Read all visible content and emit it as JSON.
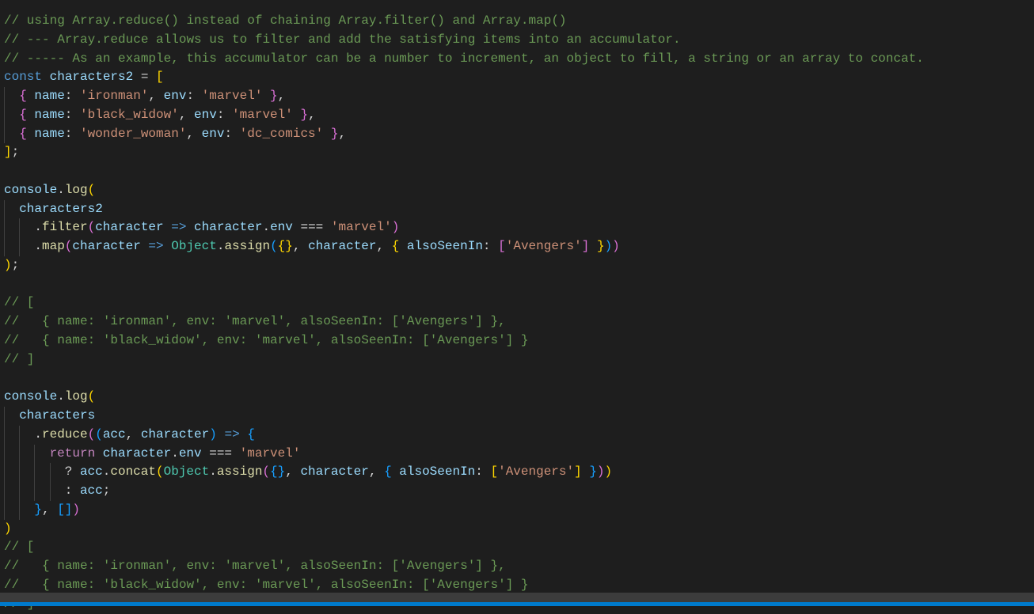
{
  "colors": {
    "background": "#1e1e1e",
    "comment": "#6a9955",
    "keyword": "#569cd6",
    "variable": "#9cdcfe",
    "string": "#ce9178",
    "status_bar": "#007acc"
  },
  "lines": [
    [
      [
        "c",
        "// using Array.reduce() instead of chaining Array.filter() and Array.map()"
      ]
    ],
    [
      [
        "c",
        "// --- Array.reduce allows us to filter and add the satisfying items into an accumulator."
      ]
    ],
    [
      [
        "c",
        "// ----- As an example, this accumulator can be a number to increment, an object to fill, a string or an array to concat."
      ]
    ],
    [
      [
        "k",
        "const "
      ],
      [
        "v",
        "characters2"
      ],
      [
        "p",
        " = "
      ],
      [
        "b1",
        "["
      ]
    ],
    [
      [
        "g",
        ""
      ],
      [
        "b2",
        "{ "
      ],
      [
        "v",
        "name"
      ],
      [
        "p",
        ": "
      ],
      [
        "s",
        "'ironman'"
      ],
      [
        "p",
        ", "
      ],
      [
        "v",
        "env"
      ],
      [
        "p",
        ": "
      ],
      [
        "s",
        "'marvel'"
      ],
      [
        "b2",
        " }"
      ],
      [
        "p",
        ","
      ]
    ],
    [
      [
        "g",
        ""
      ],
      [
        "b2",
        "{ "
      ],
      [
        "v",
        "name"
      ],
      [
        "p",
        ": "
      ],
      [
        "s",
        "'black_widow'"
      ],
      [
        "p",
        ", "
      ],
      [
        "v",
        "env"
      ],
      [
        "p",
        ": "
      ],
      [
        "s",
        "'marvel'"
      ],
      [
        "b2",
        " }"
      ],
      [
        "p",
        ","
      ]
    ],
    [
      [
        "g",
        ""
      ],
      [
        "b2",
        "{ "
      ],
      [
        "v",
        "name"
      ],
      [
        "p",
        ": "
      ],
      [
        "s",
        "'wonder_woman'"
      ],
      [
        "p",
        ", "
      ],
      [
        "v",
        "env"
      ],
      [
        "p",
        ": "
      ],
      [
        "s",
        "'dc_comics'"
      ],
      [
        "b2",
        " }"
      ],
      [
        "p",
        ","
      ]
    ],
    [
      [
        "b1",
        "]"
      ],
      [
        "p",
        ";"
      ]
    ],
    [],
    [
      [
        "v",
        "console"
      ],
      [
        "p",
        "."
      ],
      [
        "f",
        "log"
      ],
      [
        "b1",
        "("
      ]
    ],
    [
      [
        "g",
        ""
      ],
      [
        "v",
        "characters2"
      ]
    ],
    [
      [
        "g",
        ""
      ],
      [
        "g",
        ""
      ],
      [
        "p",
        "."
      ],
      [
        "f",
        "filter"
      ],
      [
        "b2",
        "("
      ],
      [
        "v",
        "character"
      ],
      [
        "k",
        " => "
      ],
      [
        "v",
        "character"
      ],
      [
        "p",
        "."
      ],
      [
        "v",
        "env"
      ],
      [
        "p",
        " === "
      ],
      [
        "s",
        "'marvel'"
      ],
      [
        "b2",
        ")"
      ]
    ],
    [
      [
        "g",
        ""
      ],
      [
        "g",
        ""
      ],
      [
        "p",
        "."
      ],
      [
        "f",
        "map"
      ],
      [
        "b2",
        "("
      ],
      [
        "v",
        "character"
      ],
      [
        "k",
        " => "
      ],
      [
        "t",
        "Object"
      ],
      [
        "p",
        "."
      ],
      [
        "f",
        "assign"
      ],
      [
        "b3",
        "("
      ],
      [
        "b1",
        "{}"
      ],
      [
        "p",
        ", "
      ],
      [
        "v",
        "character"
      ],
      [
        "p",
        ", "
      ],
      [
        "b1",
        "{ "
      ],
      [
        "v",
        "alsoSeenIn"
      ],
      [
        "p",
        ": "
      ],
      [
        "b2",
        "["
      ],
      [
        "s",
        "'Avengers'"
      ],
      [
        "b2",
        "]"
      ],
      [
        "b1",
        " }"
      ],
      [
        "b3",
        ")"
      ],
      [
        "b2",
        ")"
      ]
    ],
    [
      [
        "b1",
        ")"
      ],
      [
        "p",
        ";"
      ]
    ],
    [],
    [
      [
        "c",
        "// ["
      ]
    ],
    [
      [
        "c",
        "//   { name: 'ironman', env: 'marvel', alsoSeenIn: ['Avengers'] },"
      ]
    ],
    [
      [
        "c",
        "//   { name: 'black_widow', env: 'marvel', alsoSeenIn: ['Avengers'] }"
      ]
    ],
    [
      [
        "c",
        "// ]"
      ]
    ],
    [],
    [
      [
        "v",
        "console"
      ],
      [
        "p",
        "."
      ],
      [
        "f",
        "log"
      ],
      [
        "b1",
        "("
      ]
    ],
    [
      [
        "g",
        ""
      ],
      [
        "v",
        "characters"
      ]
    ],
    [
      [
        "g",
        ""
      ],
      [
        "g",
        ""
      ],
      [
        "p",
        "."
      ],
      [
        "f",
        "reduce"
      ],
      [
        "b2",
        "("
      ],
      [
        "b3",
        "("
      ],
      [
        "v",
        "acc"
      ],
      [
        "p",
        ", "
      ],
      [
        "v",
        "character"
      ],
      [
        "b3",
        ")"
      ],
      [
        "k",
        " => "
      ],
      [
        "b3",
        "{"
      ]
    ],
    [
      [
        "g",
        ""
      ],
      [
        "g",
        ""
      ],
      [
        "g",
        ""
      ],
      [
        "r",
        "return "
      ],
      [
        "v",
        "character"
      ],
      [
        "p",
        "."
      ],
      [
        "v",
        "env"
      ],
      [
        "p",
        " === "
      ],
      [
        "s",
        "'marvel'"
      ]
    ],
    [
      [
        "g",
        ""
      ],
      [
        "g",
        ""
      ],
      [
        "g",
        ""
      ],
      [
        "g",
        ""
      ],
      [
        "p",
        "? "
      ],
      [
        "v",
        "acc"
      ],
      [
        "p",
        "."
      ],
      [
        "f",
        "concat"
      ],
      [
        "b1",
        "("
      ],
      [
        "t",
        "Object"
      ],
      [
        "p",
        "."
      ],
      [
        "f",
        "assign"
      ],
      [
        "b2",
        "("
      ],
      [
        "b3",
        "{}"
      ],
      [
        "p",
        ", "
      ],
      [
        "v",
        "character"
      ],
      [
        "p",
        ", "
      ],
      [
        "b3",
        "{ "
      ],
      [
        "v",
        "alsoSeenIn"
      ],
      [
        "p",
        ": "
      ],
      [
        "b1",
        "["
      ],
      [
        "s",
        "'Avengers'"
      ],
      [
        "b1",
        "]"
      ],
      [
        "b3",
        " }"
      ],
      [
        "b2",
        ")"
      ],
      [
        "b1",
        ")"
      ]
    ],
    [
      [
        "g",
        ""
      ],
      [
        "g",
        ""
      ],
      [
        "g",
        ""
      ],
      [
        "g",
        ""
      ],
      [
        "p",
        ": "
      ],
      [
        "v",
        "acc"
      ],
      [
        "p",
        ";"
      ]
    ],
    [
      [
        "g",
        ""
      ],
      [
        "g",
        ""
      ],
      [
        "b3",
        "}"
      ],
      [
        "p",
        ", "
      ],
      [
        "b3",
        "[]"
      ],
      [
        "b2",
        ")"
      ]
    ],
    [
      [
        "b1",
        ")"
      ]
    ],
    [
      [
        "c",
        "// ["
      ]
    ],
    [
      [
        "c",
        "//   { name: 'ironman', env: 'marvel', alsoSeenIn: ['Avengers'] },"
      ]
    ],
    [
      [
        "c",
        "//   { name: 'black_widow', env: 'marvel', alsoSeenIn: ['Avengers'] }"
      ]
    ],
    [
      [
        "c",
        "// ]"
      ]
    ]
  ]
}
